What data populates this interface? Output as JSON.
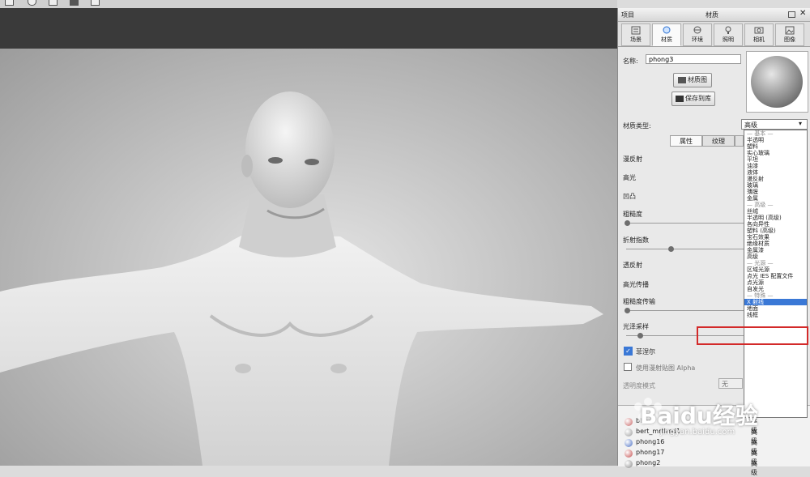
{
  "toolbar": {
    "icons": [
      "file-icon",
      "undo-icon",
      "cut-icon",
      "save-icon",
      "export-icon"
    ]
  },
  "panel": {
    "left_title": "项目",
    "title": "材质",
    "tabs": [
      {
        "label": "场景",
        "icon": "scene-icon"
      },
      {
        "label": "材质",
        "icon": "material-icon"
      },
      {
        "label": "环境",
        "icon": "environment-icon"
      },
      {
        "label": "照明",
        "icon": "lighting-icon"
      },
      {
        "label": "相机",
        "icon": "camera-icon"
      },
      {
        "label": "图像",
        "icon": "image-icon"
      }
    ],
    "name_label": "名称:",
    "name_value": "phong3",
    "texture_map_button": "材质图",
    "save_to_library_button": "保存到库",
    "material_type_label": "材质类型:",
    "material_type_value": "高级",
    "subtabs": [
      "属性",
      "纹理"
    ],
    "props": {
      "diffuse": "漫反射",
      "specular": "高光",
      "bump": "凹凸",
      "roughness": "粗糙度",
      "refraction_index": "折射指数",
      "transmission": "透反射",
      "specular_transmission": "高光传播",
      "roughness_transmission": "粗糙度传输",
      "light_sampling": "光泽采样",
      "fresnel": "菲涅尔",
      "use_diffuse_alpha": "使用漫射贴图 Alpha",
      "transparency_mode": "透明度模式",
      "transparency_value": "无"
    },
    "fresnel_checked": true,
    "use_alpha_checked": false
  },
  "dropdown": {
    "items": [
      {
        "text": "— 基本 —",
        "kind": "head"
      },
      {
        "text": "半透明",
        "kind": "item"
      },
      {
        "text": "塑料",
        "kind": "item"
      },
      {
        "text": "实心玻璃",
        "kind": "item"
      },
      {
        "text": "平坦",
        "kind": "item"
      },
      {
        "text": "油漆",
        "kind": "item"
      },
      {
        "text": "液体",
        "kind": "item"
      },
      {
        "text": "漫反射",
        "kind": "item"
      },
      {
        "text": "玻璃",
        "kind": "item"
      },
      {
        "text": "薄膜",
        "kind": "item"
      },
      {
        "text": "金属",
        "kind": "item"
      },
      {
        "text": "— 高级 —",
        "kind": "head"
      },
      {
        "text": "丝绒",
        "kind": "item"
      },
      {
        "text": "半透明 (高级)",
        "kind": "item"
      },
      {
        "text": "各向异性",
        "kind": "item"
      },
      {
        "text": "塑料 (高级)",
        "kind": "item"
      },
      {
        "text": "宝石效果",
        "kind": "item"
      },
      {
        "text": "绝缘材质",
        "kind": "item"
      },
      {
        "text": "金属漆",
        "kind": "item"
      },
      {
        "text": "高级",
        "kind": "item"
      },
      {
        "text": "— 光源 —",
        "kind": "head"
      },
      {
        "text": "区域光源",
        "kind": "item"
      },
      {
        "text": "点光 IES 配置文件",
        "kind": "item"
      },
      {
        "text": "点光源",
        "kind": "item"
      },
      {
        "text": "自发光",
        "kind": "item"
      },
      {
        "text": "— 特殊 —",
        "kind": "head"
      },
      {
        "text": "X 射线",
        "kind": "sel"
      },
      {
        "text": "地面",
        "kind": "item"
      },
      {
        "text": "线框",
        "kind": "item"
      }
    ]
  },
  "material_list": [
    {
      "name": "bbmb",
      "type": "高级",
      "color": "#c86464"
    },
    {
      "name": "bert_mrtlred1",
      "type": "高级",
      "color": "#9a9a9a"
    },
    {
      "name": "phong16",
      "type": "高级",
      "color": "#4a6fc4"
    },
    {
      "name": "phong17",
      "type": "高级",
      "color": "#c44a4a"
    },
    {
      "name": "phong2",
      "type": "高级",
      "color": "#888888"
    }
  ],
  "watermark": {
    "text": "Baidu经验",
    "url": "jingyan.baidu.com"
  },
  "colors": {
    "selection": "#3a78d6",
    "highlight": "#d32a2a"
  }
}
